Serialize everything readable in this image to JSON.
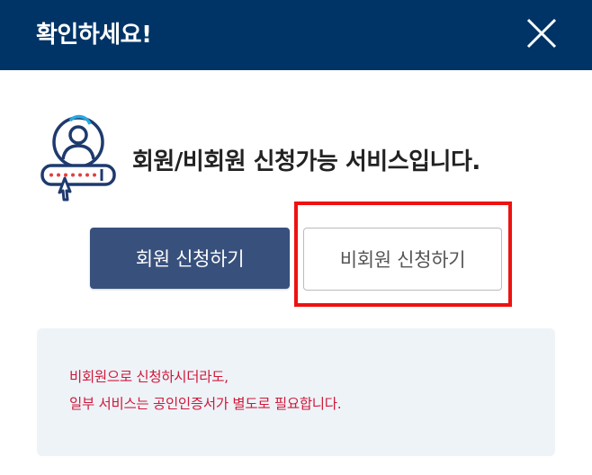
{
  "header": {
    "title": "확인하세요!",
    "background_color": "#003466",
    "close_icon": "close-icon"
  },
  "main": {
    "illustration_icon": "user-login-icon",
    "service_text": "회원/비회원 신청가능 서비스입니다.",
    "member_button_label": "회원 신청하기",
    "nonmember_button_label": "비회원 신청하기",
    "member_button_color": "#38507c"
  },
  "notice": {
    "line1": "비회원으로 신청하시더라도,",
    "line2": "일부 서비스는 공인인증서가 별도로 필요합니다.",
    "text_color": "#d0193a",
    "background_color": "#eef3f8"
  }
}
